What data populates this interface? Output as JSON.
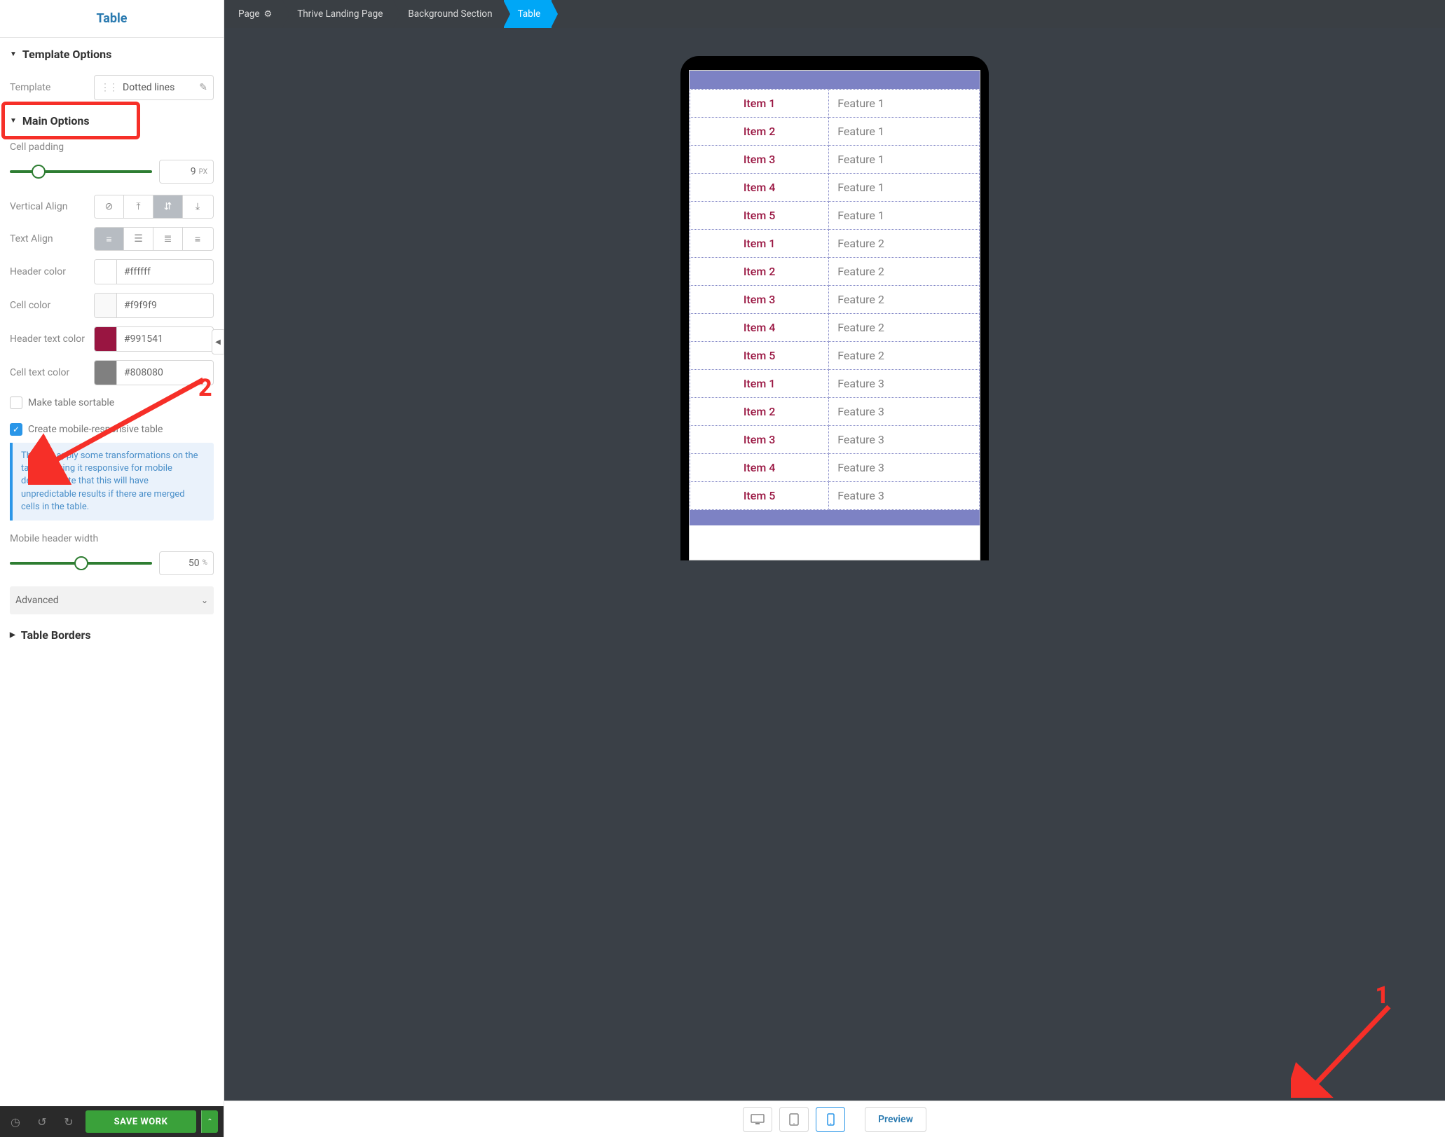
{
  "sidebar": {
    "title": "Table",
    "sections": {
      "template": {
        "title": "Template Options",
        "label": "Template",
        "value": "Dotted lines"
      },
      "main": {
        "title": "Main Options",
        "cell_padding_label": "Cell padding",
        "cell_padding_value": "9",
        "cell_padding_unit": "PX",
        "vertical_align_label": "Vertical Align",
        "text_align_label": "Text Align",
        "header_color_label": "Header color",
        "header_color_value": "#ffffff",
        "cell_color_label": "Cell color",
        "cell_color_value": "#f9f9f9",
        "header_text_color_label": "Header text color",
        "header_text_color_value": "#991541",
        "cell_text_color_label": "Cell text color",
        "cell_text_color_value": "#808080",
        "sortable_label": "Make table sortable",
        "responsive_label": "Create mobile-responsive table",
        "responsive_info": "This will apply some transformations on the table, making it responsive for mobile devices. Note that this will have unpredictable results if there are merged cells in the table.",
        "mobile_width_label": "Mobile header width",
        "mobile_width_value": "50",
        "mobile_width_unit": "%",
        "advanced_label": "Advanced"
      },
      "borders": {
        "title": "Table Borders"
      }
    },
    "footer": {
      "save_label": "SAVE WORK"
    }
  },
  "breadcrumb": {
    "items": [
      {
        "label": "Page",
        "gear": true
      },
      {
        "label": "Thrive Landing Page"
      },
      {
        "label": "Background Section"
      },
      {
        "label": "Table",
        "active": true
      }
    ]
  },
  "preview_table": {
    "rows": [
      {
        "item": "Item 1",
        "feature": "Feature 1"
      },
      {
        "item": "Item 2",
        "feature": "Feature 1"
      },
      {
        "item": "Item 3",
        "feature": "Feature 1"
      },
      {
        "item": "Item 4",
        "feature": "Feature 1"
      },
      {
        "item": "Item 5",
        "feature": "Feature 1"
      },
      {
        "item": "Item 1",
        "feature": "Feature 2"
      },
      {
        "item": "Item 2",
        "feature": "Feature 2"
      },
      {
        "item": "Item 3",
        "feature": "Feature 2"
      },
      {
        "item": "Item 4",
        "feature": "Feature 2"
      },
      {
        "item": "Item 5",
        "feature": "Feature 2"
      },
      {
        "item": "Item 1",
        "feature": "Feature 3"
      },
      {
        "item": "Item 2",
        "feature": "Feature 3"
      },
      {
        "item": "Item 3",
        "feature": "Feature 3"
      },
      {
        "item": "Item 4",
        "feature": "Feature 3"
      },
      {
        "item": "Item 5",
        "feature": "Feature 3"
      }
    ]
  },
  "bottom_bar": {
    "preview_label": "Preview"
  },
  "colors": {
    "header_swatch": "#ffffff",
    "cell_swatch": "#f9f9f9",
    "header_text_swatch": "#991541",
    "cell_text_swatch": "#808080"
  },
  "annotations": {
    "num1": "1",
    "num2": "2"
  }
}
